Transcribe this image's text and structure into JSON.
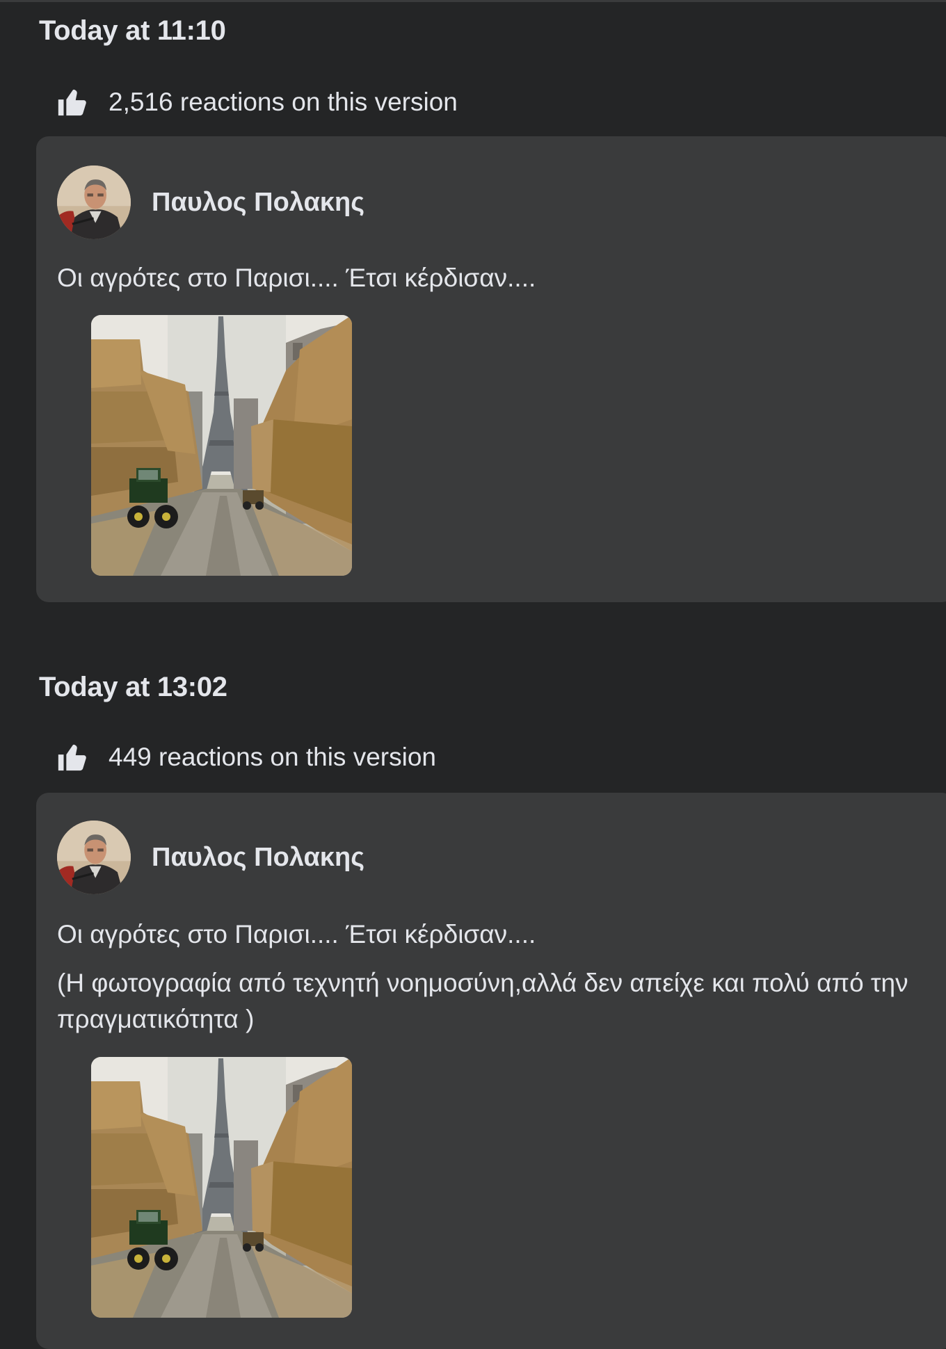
{
  "versions": [
    {
      "timestamp": "Today at 11:10",
      "reactions": "2,516 reactions on this version",
      "post": {
        "author": "Παυλος Πολακης",
        "text_lines": [
          "Οι αγρότες στο Παρισι.... Έτσι κέρδισαν...."
        ],
        "image": "eiffel-tower-hay-bales-tractors-photo"
      }
    },
    {
      "timestamp": "Today at 13:02",
      "reactions": "449 reactions on this version",
      "post": {
        "author": "Παυλος Πολακης",
        "text_lines": [
          "Οι αγρότες στο Παρισι.... Έτσι κέρδισαν....",
          "(Η φωτογραφία από τεχνητή νοημοσύνη,αλλά δεν απείχε και πολύ από την πραγματικότητα )"
        ],
        "image": "eiffel-tower-hay-bales-tractors-photo"
      }
    }
  ],
  "icons": {
    "reactions": "thumbs-up-icon"
  },
  "colors": {
    "background": "#242526",
    "card": "#3a3b3c",
    "text": "#e4e6eb"
  }
}
